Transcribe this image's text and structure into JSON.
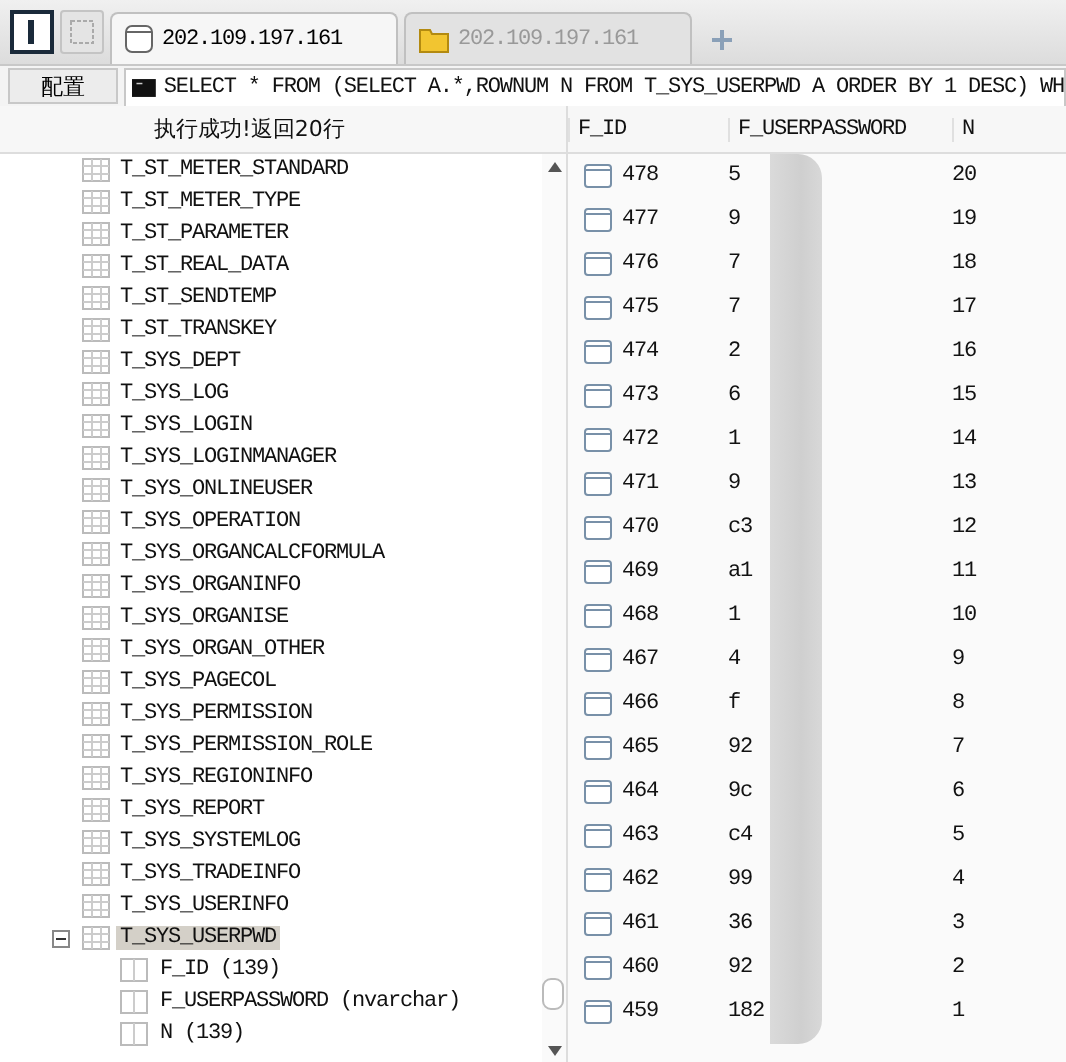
{
  "tabs": [
    {
      "label": "202.109.197.161",
      "kind": "database",
      "selected": true
    },
    {
      "label": "202.109.197.161",
      "kind": "folder",
      "selected": false
    }
  ],
  "toolbar": {
    "config_button": "配置",
    "sql": "SELECT * FROM (SELECT A.*,ROWNUM N FROM T_SYS_USERPWD A ORDER BY 1 DESC) WH"
  },
  "status": "执行成功!返回20行",
  "tree": {
    "items": [
      {
        "label": "T_ST_METER_STANDARD",
        "expanded": false,
        "selected": false
      },
      {
        "label": "T_ST_METER_TYPE",
        "expanded": false,
        "selected": false
      },
      {
        "label": "T_ST_PARAMETER",
        "expanded": false,
        "selected": false
      },
      {
        "label": "T_ST_REAL_DATA",
        "expanded": false,
        "selected": false
      },
      {
        "label": "T_ST_SENDTEMP",
        "expanded": false,
        "selected": false
      },
      {
        "label": "T_ST_TRANSKEY",
        "expanded": false,
        "selected": false
      },
      {
        "label": "T_SYS_DEPT",
        "expanded": false,
        "selected": false
      },
      {
        "label": "T_SYS_LOG",
        "expanded": false,
        "selected": false
      },
      {
        "label": "T_SYS_LOGIN",
        "expanded": false,
        "selected": false
      },
      {
        "label": "T_SYS_LOGINMANAGER",
        "expanded": false,
        "selected": false
      },
      {
        "label": "T_SYS_ONLINEUSER",
        "expanded": false,
        "selected": false
      },
      {
        "label": "T_SYS_OPERATION",
        "expanded": false,
        "selected": false
      },
      {
        "label": "T_SYS_ORGANCALCFORMULA",
        "expanded": false,
        "selected": false
      },
      {
        "label": "T_SYS_ORGANINFO",
        "expanded": false,
        "selected": false
      },
      {
        "label": "T_SYS_ORGANISE",
        "expanded": false,
        "selected": false
      },
      {
        "label": "T_SYS_ORGAN_OTHER",
        "expanded": false,
        "selected": false
      },
      {
        "label": "T_SYS_PAGECOL",
        "expanded": false,
        "selected": false
      },
      {
        "label": "T_SYS_PERMISSION",
        "expanded": false,
        "selected": false
      },
      {
        "label": "T_SYS_PERMISSION_ROLE",
        "expanded": false,
        "selected": false
      },
      {
        "label": "T_SYS_REGIONINFO",
        "expanded": false,
        "selected": false
      },
      {
        "label": "T_SYS_REPORT",
        "expanded": false,
        "selected": false
      },
      {
        "label": "T_SYS_SYSTEMLOG",
        "expanded": false,
        "selected": false
      },
      {
        "label": "T_SYS_TRADEINFO",
        "expanded": false,
        "selected": false
      },
      {
        "label": "T_SYS_USERINFO",
        "expanded": false,
        "selected": false
      },
      {
        "label": "T_SYS_USERPWD",
        "expanded": true,
        "selected": true,
        "children": [
          {
            "label": "F_ID (139)"
          },
          {
            "label": "F_USERPASSWORD (nvarchar)"
          },
          {
            "label": "N (139)"
          }
        ]
      }
    ]
  },
  "grid": {
    "columns": [
      "F_ID",
      "F_USERPASSWORD",
      "N"
    ],
    "rows": [
      [
        "478",
        "5",
        "20"
      ],
      [
        "477",
        "9",
        "19"
      ],
      [
        "476",
        "7",
        "18"
      ],
      [
        "475",
        "7",
        "17"
      ],
      [
        "474",
        "2",
        "16"
      ],
      [
        "473",
        "6",
        "15"
      ],
      [
        "472",
        "1",
        "14"
      ],
      [
        "471",
        "9",
        "13"
      ],
      [
        "470",
        "c3",
        "12"
      ],
      [
        "469",
        "a1",
        "11"
      ],
      [
        "468",
        "1",
        "10"
      ],
      [
        "467",
        "4",
        "9"
      ],
      [
        "466",
        "f",
        "8"
      ],
      [
        "465",
        "92",
        "7"
      ],
      [
        "464",
        "9c",
        "6"
      ],
      [
        "463",
        "c4",
        "5"
      ],
      [
        "462",
        "99",
        "4"
      ],
      [
        "461",
        "36",
        "3"
      ],
      [
        "460",
        "92",
        "2"
      ],
      [
        "459",
        "182",
        "1"
      ]
    ]
  }
}
